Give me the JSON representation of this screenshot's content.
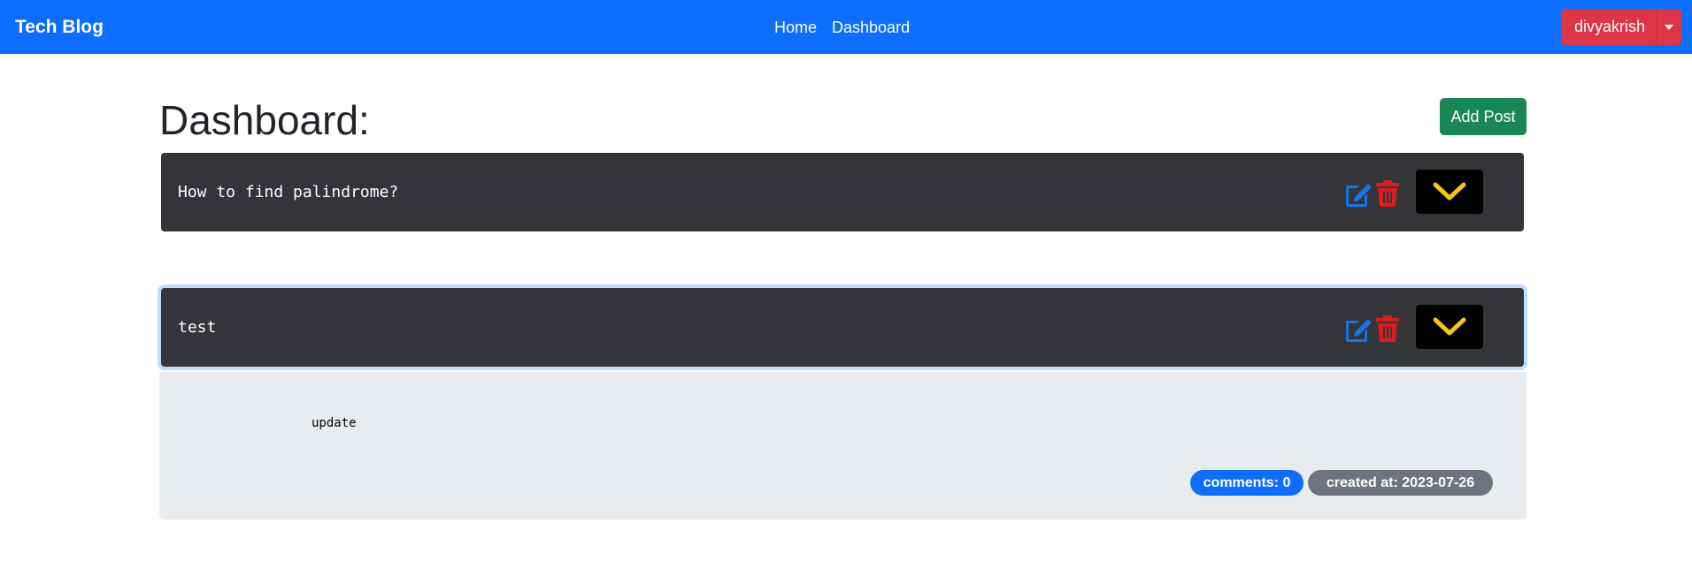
{
  "navbar": {
    "brand": "Tech Blog",
    "links": [
      "Home",
      "Dashboard"
    ],
    "user": "divyakrish",
    "color": "#0d6efd"
  },
  "page": {
    "title": "Dashboard:",
    "add_post_label": "Add Post"
  },
  "posts": [
    {
      "title": "How to find palindrome?",
      "icons": [
        "edit-icon",
        "trash-icon",
        "chevron-down-icon"
      ],
      "expanded": false
    },
    {
      "title": "test",
      "icons": [
        "edit-icon",
        "trash-icon",
        "chevron-down-icon"
      ],
      "expanded": true,
      "content": "update",
      "comments_badge": "comments: 0",
      "created_badge": "created at: 2023-07-26"
    }
  ],
  "colors": {
    "edit": "#1a73e8",
    "trash": "#dc1d1d",
    "chevron": "#f5c518",
    "post_header_bg": "#343538",
    "add_post": "#198754",
    "user_button": "#dc3545"
  }
}
